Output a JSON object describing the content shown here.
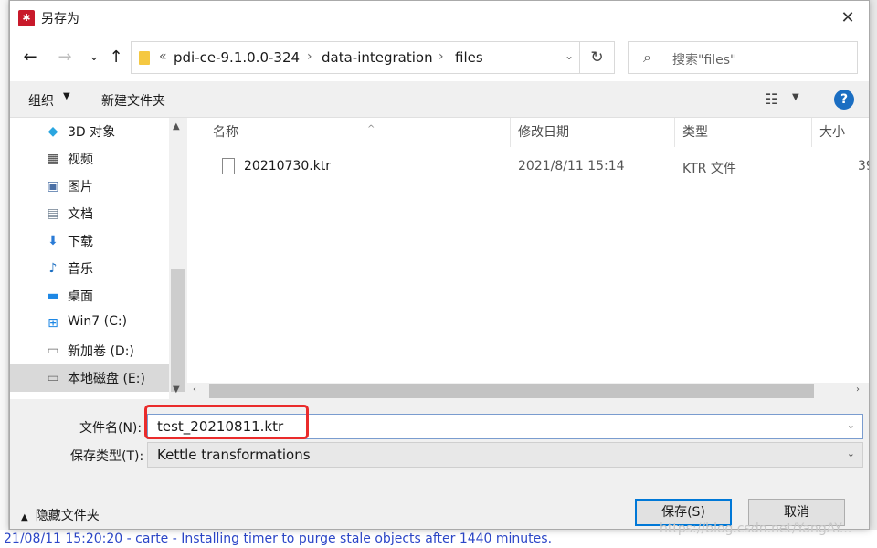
{
  "window": {
    "title": "另存为",
    "close_glyph": "✕"
  },
  "nav": {
    "back_glyph": "←",
    "forward_glyph": "→",
    "recent_glyph": "⌄",
    "up_glyph": "↑"
  },
  "address": {
    "overflow_glyph": "«",
    "crumbs": [
      "pdi-ce-9.1.0.0-324",
      "data-integration",
      "files"
    ],
    "sep_glyph": "›",
    "dropdown_glyph": "⌄",
    "refresh_glyph": "↻"
  },
  "search": {
    "placeholder": "搜索\"files\"",
    "icon_glyph": "⌕"
  },
  "toolbar": {
    "organize": "组织",
    "organize_chev": "▼",
    "new_folder": "新建文件夹",
    "view_glyph": "☷",
    "view_chev": "▼",
    "help_glyph": "?"
  },
  "sidebar": {
    "items": [
      {
        "label": "3D 对象",
        "icon": "cube-icon",
        "glyph": "◆",
        "color": "#2aa6e0"
      },
      {
        "label": "视频",
        "icon": "film-icon",
        "glyph": "▦",
        "color": "#444444"
      },
      {
        "label": "图片",
        "icon": "picture-icon",
        "glyph": "▣",
        "color": "#4a6fa5"
      },
      {
        "label": "文档",
        "icon": "document-icon",
        "glyph": "▤",
        "color": "#6f7f91"
      },
      {
        "label": "下载",
        "icon": "download-icon",
        "glyph": "⬇",
        "color": "#2a7bd6"
      },
      {
        "label": "音乐",
        "icon": "music-icon",
        "glyph": "♪",
        "color": "#1b6ec2"
      },
      {
        "label": "桌面",
        "icon": "desktop-icon",
        "glyph": "▬",
        "color": "#1e88e5"
      },
      {
        "label": "Win7 (C:)",
        "icon": "windows-drive-icon",
        "glyph": "⊞",
        "color": "#1e88e5"
      },
      {
        "label": "新加卷 (D:)",
        "icon": "drive-icon",
        "glyph": "▭",
        "color": "#666666"
      },
      {
        "label": "本地磁盘 (E:)",
        "icon": "drive-icon",
        "glyph": "▭",
        "color": "#666666",
        "selected": true
      }
    ],
    "scroll_up": "▲",
    "scroll_down": "▼"
  },
  "columns": {
    "name": "名称",
    "modified": "修改日期",
    "type": "类型",
    "size": "大小",
    "sort_glyph": "^"
  },
  "files": [
    {
      "name": "20210730.ktr",
      "modified": "2021/8/11 15:14",
      "type": "KTR 文件",
      "size": "39"
    }
  ],
  "hscroll": {
    "left": "‹",
    "right": "›"
  },
  "form": {
    "filename_label": "文件名(N):",
    "filename_value": "test_20210811.ktr",
    "filetype_label": "保存类型(T):",
    "filetype_value": "Kettle transformations",
    "dropdown_glyph": "⌄"
  },
  "footer": {
    "hide_folders": "隐藏文件夹",
    "hide_chev": "▲",
    "save": "保存(S)",
    "cancel": "取消",
    "watermark": "https://blog.csdn.net/YangAY..."
  },
  "background_text": {
    "line": "21/08/11 15:20:20 - carte - Installing timer to purge stale objects after 1440 minutes."
  },
  "colors": {
    "accent": "#0078d7",
    "highlight_border": "#ea2b2b"
  }
}
